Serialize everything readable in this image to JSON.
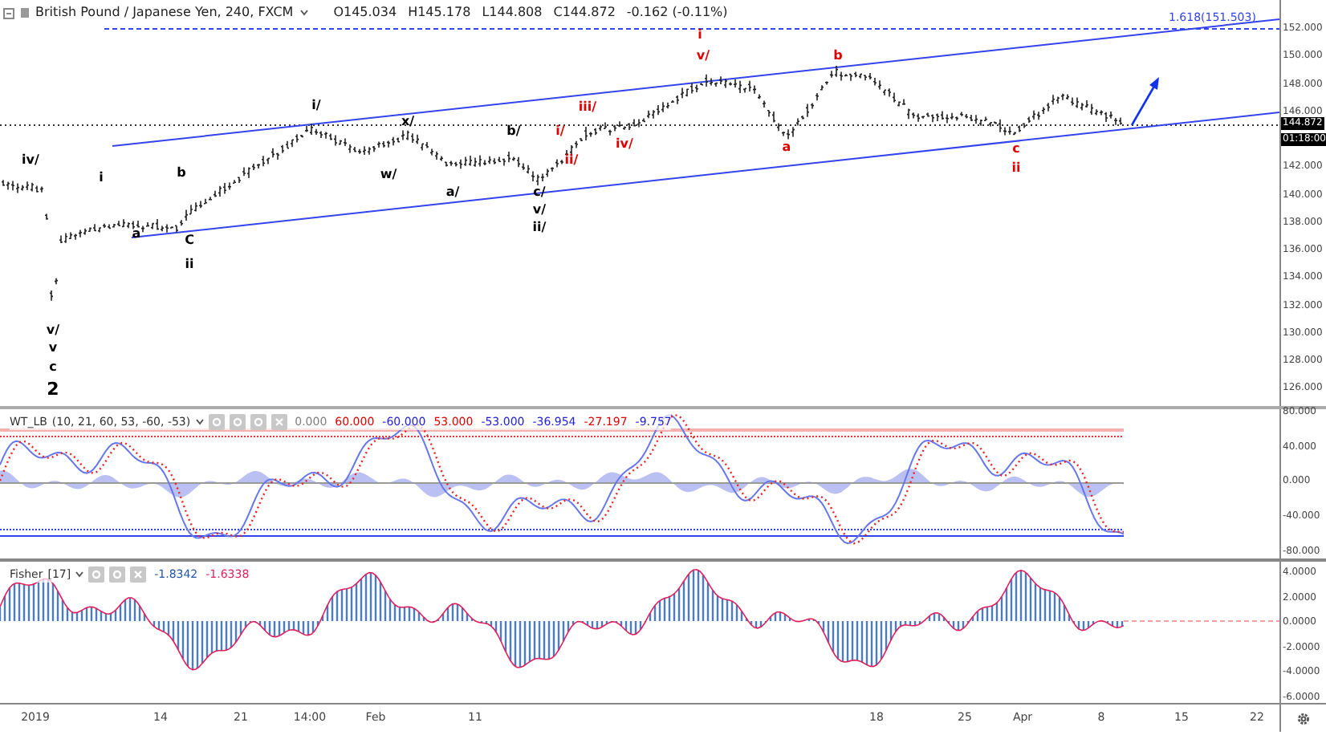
{
  "header": {
    "symbol": "British Pound / Japanese Yen, 240, FXCM",
    "ohlc": [
      "O145.034",
      "H145.178",
      "L144.808",
      "C144.872"
    ],
    "change": "-0.162 (-0.11%)"
  },
  "price_chart": {
    "fib_label": "1.618(151.503)",
    "price_tag": "144.872",
    "countdown": "01:18:00",
    "y_ticks": [
      "152.000",
      "150.000",
      "148.000",
      "146.000",
      "142.000",
      "140.000",
      "138.000",
      "136.000",
      "134.000",
      "132.000",
      "130.000",
      "128.000",
      "126.000"
    ],
    "wave_labels": [
      {
        "text": "iv/",
        "color": "#000000",
        "kind": "minor"
      },
      {
        "text": "i",
        "color": "#000000",
        "kind": "minor"
      },
      {
        "text": "b",
        "color": "#000000",
        "kind": "minor"
      },
      {
        "text": "a",
        "color": "#000000",
        "kind": "minor"
      },
      {
        "text": "C",
        "color": "#000000",
        "kind": "minor"
      },
      {
        "text": "ii",
        "color": "#000000",
        "kind": "minor"
      },
      {
        "text": "i/",
        "color": "#000000",
        "kind": "minor"
      },
      {
        "text": "x/",
        "color": "#000000",
        "kind": "minor"
      },
      {
        "text": "w/",
        "color": "#000000",
        "kind": "minor"
      },
      {
        "text": "a/",
        "color": "#000000",
        "kind": "minor"
      },
      {
        "text": "b/",
        "color": "#000000",
        "kind": "minor"
      },
      {
        "text": "c/",
        "color": "#000000",
        "kind": "minor"
      },
      {
        "text": "v/",
        "color": "#000000",
        "kind": "minor"
      },
      {
        "text": "ii/",
        "color": "#000000",
        "kind": "minor"
      },
      {
        "text": "i/",
        "color": "#e00000",
        "kind": "minor"
      },
      {
        "text": "iii/",
        "color": "#e00000",
        "kind": "minor"
      },
      {
        "text": "ii/",
        "color": "#e00000",
        "kind": "minor"
      },
      {
        "text": "iv/",
        "color": "#e00000",
        "kind": "minor"
      },
      {
        "text": "i",
        "color": "#e00000",
        "kind": "minor"
      },
      {
        "text": "v/",
        "color": "#e00000",
        "kind": "minor"
      },
      {
        "text": "a",
        "color": "#e00000",
        "kind": "minor"
      },
      {
        "text": "b",
        "color": "#e00000",
        "kind": "minor"
      },
      {
        "text": "c",
        "color": "#e00000",
        "kind": "minor"
      },
      {
        "text": "ii",
        "color": "#e00000",
        "kind": "minor"
      },
      {
        "text": "v/",
        "color": "#000000",
        "kind": "minor"
      },
      {
        "text": "v",
        "color": "#000000",
        "kind": "minor"
      },
      {
        "text": "c",
        "color": "#000000",
        "kind": "minor"
      },
      {
        "text": "2",
        "color": "#000000",
        "kind": "major"
      }
    ]
  },
  "wt_panel": {
    "name": "WT_LB",
    "params": "(10, 21, 60, 53, -60, -53)",
    "values": [
      {
        "text": "0.000",
        "color": "#808080"
      },
      {
        "text": "60.000",
        "color": "#e00000"
      },
      {
        "text": "-60.000",
        "color": "#2222dd"
      },
      {
        "text": "53.000",
        "color": "#e00000"
      },
      {
        "text": "-53.000",
        "color": "#2222dd"
      },
      {
        "text": "-36.954",
        "color": "#2222dd"
      },
      {
        "text": "-27.197",
        "color": "#e00000"
      },
      {
        "text": "-9.757",
        "color": "#2222dd"
      }
    ],
    "y_ticks": [
      "80.000",
      "40.000",
      "0.000",
      "-40.000",
      "-80.000"
    ]
  },
  "fisher_panel": {
    "name": "Fisher",
    "params": "[17]",
    "values": [
      {
        "text": "-1.8342",
        "color": "#2255aa"
      },
      {
        "text": "-1.6338",
        "color": "#e0205a"
      }
    ],
    "y_ticks": [
      "4.0000",
      "2.0000",
      "0.0000",
      "-2.0000",
      "-4.0000",
      "-6.0000"
    ]
  },
  "time_axis": {
    "labels": [
      "2019",
      "14",
      "21",
      "14:00",
      "Feb",
      "11",
      "18",
      "25",
      "Apr",
      "8",
      "15",
      "22"
    ]
  }
}
